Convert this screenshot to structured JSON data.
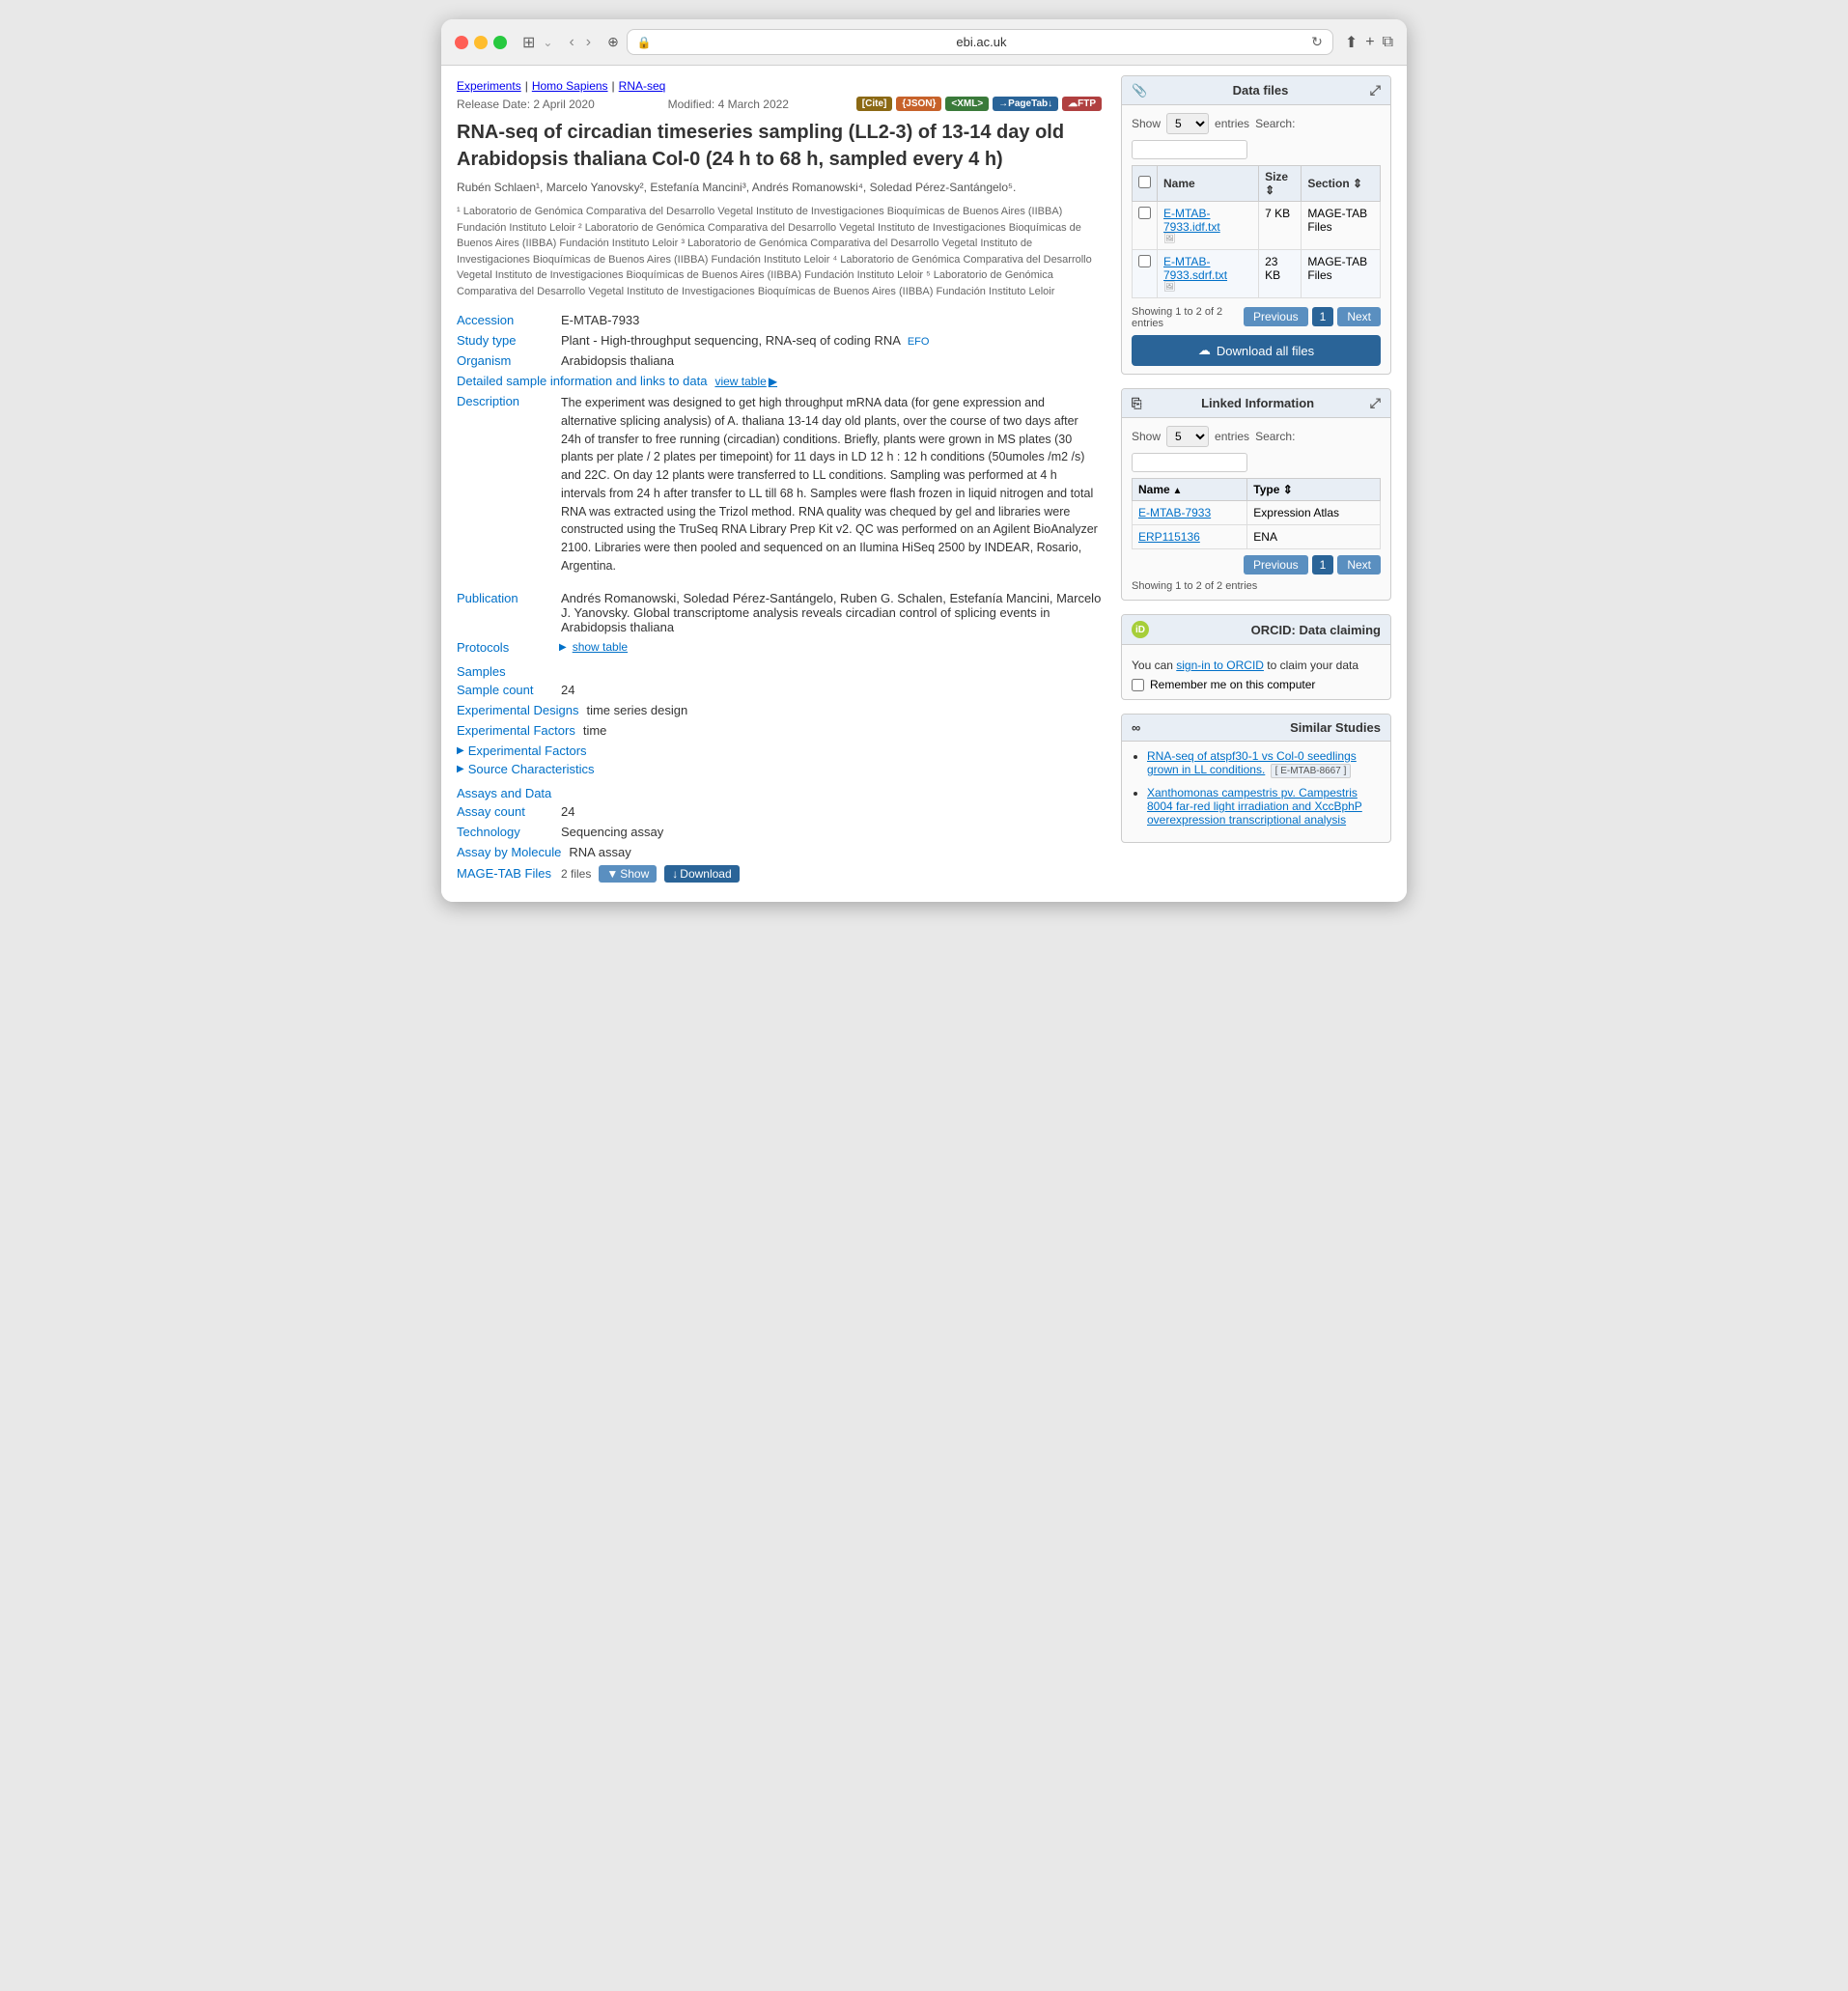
{
  "browser": {
    "url": "ebi.ac.uk",
    "back_btn": "‹",
    "forward_btn": "›"
  },
  "breadcrumb": {
    "items": [
      "Experiments",
      "Homo Sapiens",
      "RNA-seq"
    ]
  },
  "meta": {
    "release_date": "Release Date: 2 April 2020",
    "modified_date": "Modified: 4 March 2022",
    "buttons": {
      "cite": "[Cite]",
      "json": "{JSON}",
      "xml": "<XML>",
      "pagetab": "→PageTab↓",
      "ftp": "☁FTP"
    }
  },
  "title": "RNA-seq of circadian timeseries sampling (LL2-3) of 13-14 day old Arabidopsis thaliana Col-0 (24 h to 68 h, sampled every 4 h)",
  "authors": "Rubén Schlaen¹, Marcelo Yanovsky², Estefanía Mancini³, Andrés Romanowski⁴, Soledad Pérez-Santángelo⁵.",
  "affiliations": [
    "¹ Laboratorio de Genómica Comparativa del Desarrollo Vegetal Instituto de Investigaciones Bioquímicas de Buenos Aires (IIBBA) Fundación Instituto Leloir",
    "² Laboratorio de Genómica Comparativa del Desarrollo Vegetal Instituto de Investigaciones Bioquímicas de Buenos Aires (IIBBA) Fundación Instituto Leloir",
    "³ Laboratorio de Genómica Comparativa del Desarrollo Vegetal Instituto de Investigaciones Bioquímicas de Buenos Aires (IIBBA) Fundación Instituto Leloir",
    "⁴ Laboratorio de Genómica Comparativa del Desarrollo Vegetal Instituto de Investigaciones Bioquímicas de Buenos Aires (IIBBA) Fundación Instituto Leloir",
    "⁵ Laboratorio de Genómica Comparativa del Desarrollo Vegetal Instituto de Investigaciones Bioquímicas de Buenos Aires (IIBBA) Fundación Instituto Leloir"
  ],
  "info": {
    "accession_label": "Accession",
    "accession_value": "E-MTAB-7933",
    "study_type_label": "Study type",
    "study_type_value": "Plant - High-throughput sequencing, RNA-seq of coding RNA",
    "study_type_efo": "EFO",
    "organism_label": "Organism",
    "organism_value": "Arabidopsis thaliana",
    "detailed_label": "Detailed sample information and links to data",
    "view_table_label": "view table"
  },
  "description": {
    "label": "Description",
    "text": "The experiment was designed to get high throughput mRNA data (for gene expression and alternative splicing analysis) of A. thaliana 13-14 day old plants, over the course of two days after 24h of transfer to free running (circadian) conditions. Briefly, plants were grown in MS plates (30 plants per plate / 2 plates per timepoint) for 11 days in LD 12 h : 12 h conditions (50umoles /m2 /s) and 22C. On day 12 plants were transferred to LL conditions. Sampling was performed at 4 h intervals from 24 h after transfer to LL till 68 h. Samples were flash frozen in liquid nitrogen and total RNA was extracted using the Trizol method. RNA quality was chequed by gel and libraries were constructed using the TruSeq RNA Library Prep Kit v2. QC was performed on an Agilent BioAnalyzer 2100. Libraries were then pooled and sequenced on an Ilumina HiSeq 2500 by INDEAR, Rosario, Argentina."
  },
  "publication": {
    "label": "Publication",
    "text": "Andrés Romanowski, Soledad Pérez-Santángelo, Ruben G. Schalen, Estefanía Mancini, Marcelo J. Yanovsky. Global transcriptome analysis reveals circadian control of splicing events in Arabidopsis thaliana"
  },
  "protocols": {
    "label": "Protocols",
    "show_table_label": "show table"
  },
  "samples": {
    "label": "Samples",
    "sample_count_label": "Sample count",
    "sample_count_value": "24",
    "experimental_designs_label": "Experimental Designs",
    "experimental_designs_value": "time series design",
    "experimental_factors_label": "Experimental Factors",
    "experimental_factors_value": "time",
    "experimental_factors_expand": "Experimental Factors",
    "source_characteristics_expand": "Source Characteristics"
  },
  "assays": {
    "label": "Assays and Data",
    "assay_count_label": "Assay count",
    "assay_count_value": "24",
    "technology_label": "Technology",
    "technology_value": "Sequencing assay",
    "assay_by_molecule_label": "Assay by Molecule",
    "assay_by_molecule_value": "RNA assay",
    "mage_tab_label": "MAGE-TAB Files",
    "mage_tab_files_count": "2 files",
    "mage_tab_show": "▼ Show",
    "mage_tab_download": "↓ Download"
  },
  "sidebar": {
    "data_files": {
      "panel_title": "Data files",
      "show_label": "Show",
      "entries_label": "entries",
      "search_label": "Search:",
      "show_value": "5",
      "columns": [
        "",
        "Name",
        "Size",
        "Section"
      ],
      "files": [
        {
          "name": "E-MTAB-7933.idf.txt",
          "size": "7 KB",
          "section": "MAGE-TAB Files"
        },
        {
          "name": "E-MTAB-7933.sdrf.txt",
          "size": "23 KB",
          "section": "MAGE-TAB Files"
        }
      ],
      "showing_text": "Showing 1 to 2 of 2 entries",
      "previous_btn": "Previous",
      "next_btn": "Next",
      "page_num": "1",
      "download_all_label": "Download all files"
    },
    "linked_information": {
      "panel_title": "Linked Information",
      "show_label": "Show",
      "entries_label": "entries",
      "search_label": "Search:",
      "show_value": "5",
      "columns": [
        "Name",
        "Type"
      ],
      "rows": [
        {
          "name": "E-MTAB-7933",
          "type": "Expression Atlas"
        },
        {
          "name": "ERP115136",
          "type": "ENA"
        }
      ],
      "showing_text": "Showing 1 to 2 of 2 entries",
      "previous_btn": "Previous",
      "next_btn": "Next",
      "page_num": "1"
    },
    "orcid": {
      "panel_title": "ORCID: Data claiming",
      "logo_text": "iD",
      "description": "You can sign-in to ORCID to claim your data",
      "signin_label": "sign-in to ORCID",
      "remember_me_label": "Remember me on this computer"
    },
    "similar_studies": {
      "panel_title": "Similar Studies",
      "studies": [
        {
          "title": "RNA-seq of atspf30-1 vs Col-0 seedlings grown in LL conditions.",
          "badge": "[ E-MTAB-8667 ]"
        },
        {
          "title": "Xanthomonas campestris pv. Campestris 8004 far-red light irradiation and XccBphP overexpression transcriptional analysis",
          "badge": ""
        }
      ]
    }
  }
}
